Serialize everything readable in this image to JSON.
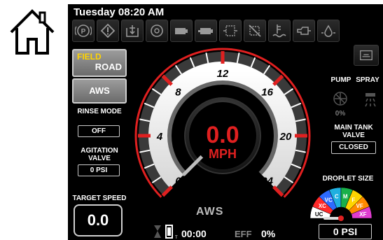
{
  "header": {
    "datetime": "Tuesday 08:20 AM"
  },
  "icon_bar": [
    {
      "icon": "parking-brake-icon"
    },
    {
      "icon": "warning-icon"
    },
    {
      "icon": "engine-service-icon"
    },
    {
      "icon": "transmission-icon"
    },
    {
      "icon": "battery-icon"
    },
    {
      "icon": "battery-2-icon"
    },
    {
      "icon": "def-filter-icon"
    },
    {
      "icon": "regen-inhibit-icon"
    },
    {
      "icon": "coolant-level-icon"
    },
    {
      "icon": "fuel-injector-icon"
    },
    {
      "icon": "oil-pressure-icon"
    }
  ],
  "left_panel": {
    "mode_field": "FIELD",
    "mode_road": "ROAD",
    "aws_button": "AWS",
    "rinse_mode_label": "RINSE MODE",
    "rinse_mode_value": "OFF",
    "agitation_label": "AGITATION VALVE",
    "agitation_value": "0  PSI",
    "target_speed_label": "TARGET SPEED",
    "target_speed_value": "0.0"
  },
  "gauge": {
    "speed": "0.0",
    "unit": "MPH",
    "ticks": [
      "0",
      "4",
      "8",
      "12",
      "16",
      "20",
      "24"
    ],
    "mode_label": "AWS"
  },
  "bottom": {
    "time": "00:00",
    "eff_label": "EFF",
    "eff_value": "0%"
  },
  "right_panel": {
    "pump_label": "PUMP",
    "spray_label": "SPRAY",
    "pump_percent": "0%",
    "main_tank_label": "MAIN TANK VALVE",
    "main_tank_value": "CLOSED",
    "droplet_label": "DROPLET SIZE",
    "droplet_classes": [
      "UC",
      "XC",
      "VC",
      "C",
      "M",
      "F",
      "VF",
      "XF"
    ],
    "pressure": "0  PSI"
  },
  "colors": {
    "accent_red": "#e02020",
    "field_yellow": "#ffd400"
  }
}
